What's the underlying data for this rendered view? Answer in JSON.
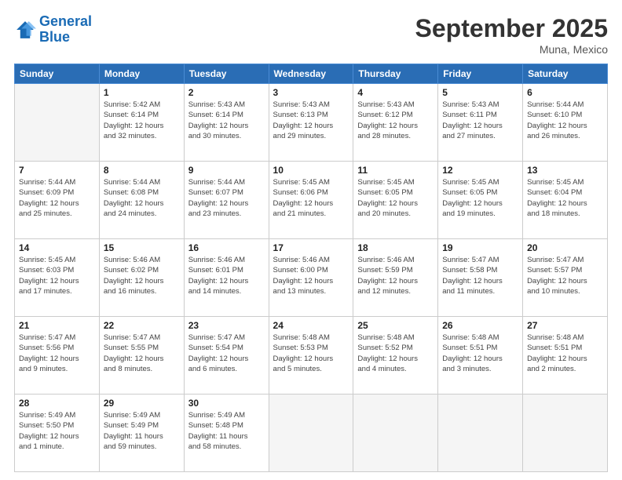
{
  "logo": {
    "line1": "General",
    "line2": "Blue"
  },
  "title": "September 2025",
  "subtitle": "Muna, Mexico",
  "days_of_week": [
    "Sunday",
    "Monday",
    "Tuesday",
    "Wednesday",
    "Thursday",
    "Friday",
    "Saturday"
  ],
  "weeks": [
    [
      {
        "num": "",
        "info": ""
      },
      {
        "num": "1",
        "info": "Sunrise: 5:42 AM\nSunset: 6:14 PM\nDaylight: 12 hours\nand 32 minutes."
      },
      {
        "num": "2",
        "info": "Sunrise: 5:43 AM\nSunset: 6:14 PM\nDaylight: 12 hours\nand 30 minutes."
      },
      {
        "num": "3",
        "info": "Sunrise: 5:43 AM\nSunset: 6:13 PM\nDaylight: 12 hours\nand 29 minutes."
      },
      {
        "num": "4",
        "info": "Sunrise: 5:43 AM\nSunset: 6:12 PM\nDaylight: 12 hours\nand 28 minutes."
      },
      {
        "num": "5",
        "info": "Sunrise: 5:43 AM\nSunset: 6:11 PM\nDaylight: 12 hours\nand 27 minutes."
      },
      {
        "num": "6",
        "info": "Sunrise: 5:44 AM\nSunset: 6:10 PM\nDaylight: 12 hours\nand 26 minutes."
      }
    ],
    [
      {
        "num": "7",
        "info": "Sunrise: 5:44 AM\nSunset: 6:09 PM\nDaylight: 12 hours\nand 25 minutes."
      },
      {
        "num": "8",
        "info": "Sunrise: 5:44 AM\nSunset: 6:08 PM\nDaylight: 12 hours\nand 24 minutes."
      },
      {
        "num": "9",
        "info": "Sunrise: 5:44 AM\nSunset: 6:07 PM\nDaylight: 12 hours\nand 23 minutes."
      },
      {
        "num": "10",
        "info": "Sunrise: 5:45 AM\nSunset: 6:06 PM\nDaylight: 12 hours\nand 21 minutes."
      },
      {
        "num": "11",
        "info": "Sunrise: 5:45 AM\nSunset: 6:05 PM\nDaylight: 12 hours\nand 20 minutes."
      },
      {
        "num": "12",
        "info": "Sunrise: 5:45 AM\nSunset: 6:05 PM\nDaylight: 12 hours\nand 19 minutes."
      },
      {
        "num": "13",
        "info": "Sunrise: 5:45 AM\nSunset: 6:04 PM\nDaylight: 12 hours\nand 18 minutes."
      }
    ],
    [
      {
        "num": "14",
        "info": "Sunrise: 5:45 AM\nSunset: 6:03 PM\nDaylight: 12 hours\nand 17 minutes."
      },
      {
        "num": "15",
        "info": "Sunrise: 5:46 AM\nSunset: 6:02 PM\nDaylight: 12 hours\nand 16 minutes."
      },
      {
        "num": "16",
        "info": "Sunrise: 5:46 AM\nSunset: 6:01 PM\nDaylight: 12 hours\nand 14 minutes."
      },
      {
        "num": "17",
        "info": "Sunrise: 5:46 AM\nSunset: 6:00 PM\nDaylight: 12 hours\nand 13 minutes."
      },
      {
        "num": "18",
        "info": "Sunrise: 5:46 AM\nSunset: 5:59 PM\nDaylight: 12 hours\nand 12 minutes."
      },
      {
        "num": "19",
        "info": "Sunrise: 5:47 AM\nSunset: 5:58 PM\nDaylight: 12 hours\nand 11 minutes."
      },
      {
        "num": "20",
        "info": "Sunrise: 5:47 AM\nSunset: 5:57 PM\nDaylight: 12 hours\nand 10 minutes."
      }
    ],
    [
      {
        "num": "21",
        "info": "Sunrise: 5:47 AM\nSunset: 5:56 PM\nDaylight: 12 hours\nand 9 minutes."
      },
      {
        "num": "22",
        "info": "Sunrise: 5:47 AM\nSunset: 5:55 PM\nDaylight: 12 hours\nand 8 minutes."
      },
      {
        "num": "23",
        "info": "Sunrise: 5:47 AM\nSunset: 5:54 PM\nDaylight: 12 hours\nand 6 minutes."
      },
      {
        "num": "24",
        "info": "Sunrise: 5:48 AM\nSunset: 5:53 PM\nDaylight: 12 hours\nand 5 minutes."
      },
      {
        "num": "25",
        "info": "Sunrise: 5:48 AM\nSunset: 5:52 PM\nDaylight: 12 hours\nand 4 minutes."
      },
      {
        "num": "26",
        "info": "Sunrise: 5:48 AM\nSunset: 5:51 PM\nDaylight: 12 hours\nand 3 minutes."
      },
      {
        "num": "27",
        "info": "Sunrise: 5:48 AM\nSunset: 5:51 PM\nDaylight: 12 hours\nand 2 minutes."
      }
    ],
    [
      {
        "num": "28",
        "info": "Sunrise: 5:49 AM\nSunset: 5:50 PM\nDaylight: 12 hours\nand 1 minute."
      },
      {
        "num": "29",
        "info": "Sunrise: 5:49 AM\nSunset: 5:49 PM\nDaylight: 11 hours\nand 59 minutes."
      },
      {
        "num": "30",
        "info": "Sunrise: 5:49 AM\nSunset: 5:48 PM\nDaylight: 11 hours\nand 58 minutes."
      },
      {
        "num": "",
        "info": ""
      },
      {
        "num": "",
        "info": ""
      },
      {
        "num": "",
        "info": ""
      },
      {
        "num": "",
        "info": ""
      }
    ]
  ]
}
